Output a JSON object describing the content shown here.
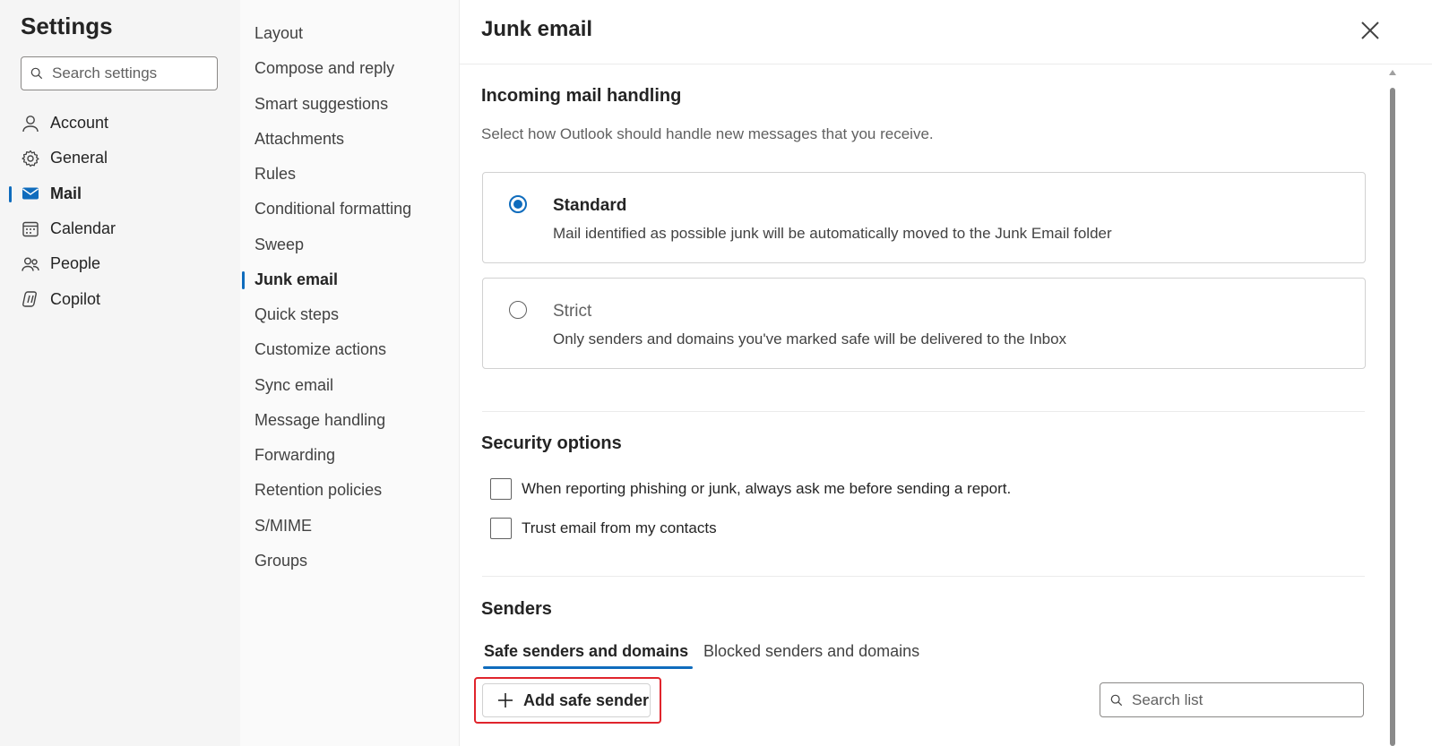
{
  "nav": {
    "title": "Settings",
    "search_placeholder": "Search settings",
    "items": [
      {
        "label": "Account",
        "icon": "person-icon"
      },
      {
        "label": "General",
        "icon": "gear-icon"
      },
      {
        "label": "Mail",
        "icon": "mail-icon",
        "active": true
      },
      {
        "label": "Calendar",
        "icon": "calendar-icon"
      },
      {
        "label": "People",
        "icon": "people-icon"
      },
      {
        "label": "Copilot",
        "icon": "copilot-icon"
      }
    ]
  },
  "submenu": {
    "items": [
      "Layout",
      "Compose and reply",
      "Smart suggestions",
      "Attachments",
      "Rules",
      "Conditional formatting",
      "Sweep",
      "Junk email",
      "Quick steps",
      "Customize actions",
      "Sync email",
      "Message handling",
      "Forwarding",
      "Retention policies",
      "S/MIME",
      "Groups"
    ],
    "active": "Junk email"
  },
  "content": {
    "title": "Junk email",
    "incoming": {
      "heading": "Incoming mail handling",
      "description": "Select how Outlook should handle new messages that you receive.",
      "options": [
        {
          "title": "Standard",
          "description": "Mail identified as possible junk will be automatically moved to the Junk Email folder",
          "selected": true
        },
        {
          "title": "Strict",
          "description": "Only senders and domains you've marked safe will be delivered to the Inbox",
          "selected": false
        }
      ]
    },
    "security": {
      "heading": "Security options",
      "options": [
        {
          "label": "When reporting phishing or junk, always ask me before sending a report.",
          "checked": false
        },
        {
          "label": "Trust email from my contacts",
          "checked": false
        }
      ]
    },
    "senders": {
      "heading": "Senders",
      "tabs": [
        "Safe senders and domains",
        "Blocked senders and domains"
      ],
      "active_tab": "Safe senders and domains",
      "add_button": "Add safe sender",
      "search_placeholder": "Search list"
    }
  },
  "colors": {
    "accent": "#0f6cbd",
    "highlight": "#e0242c"
  }
}
